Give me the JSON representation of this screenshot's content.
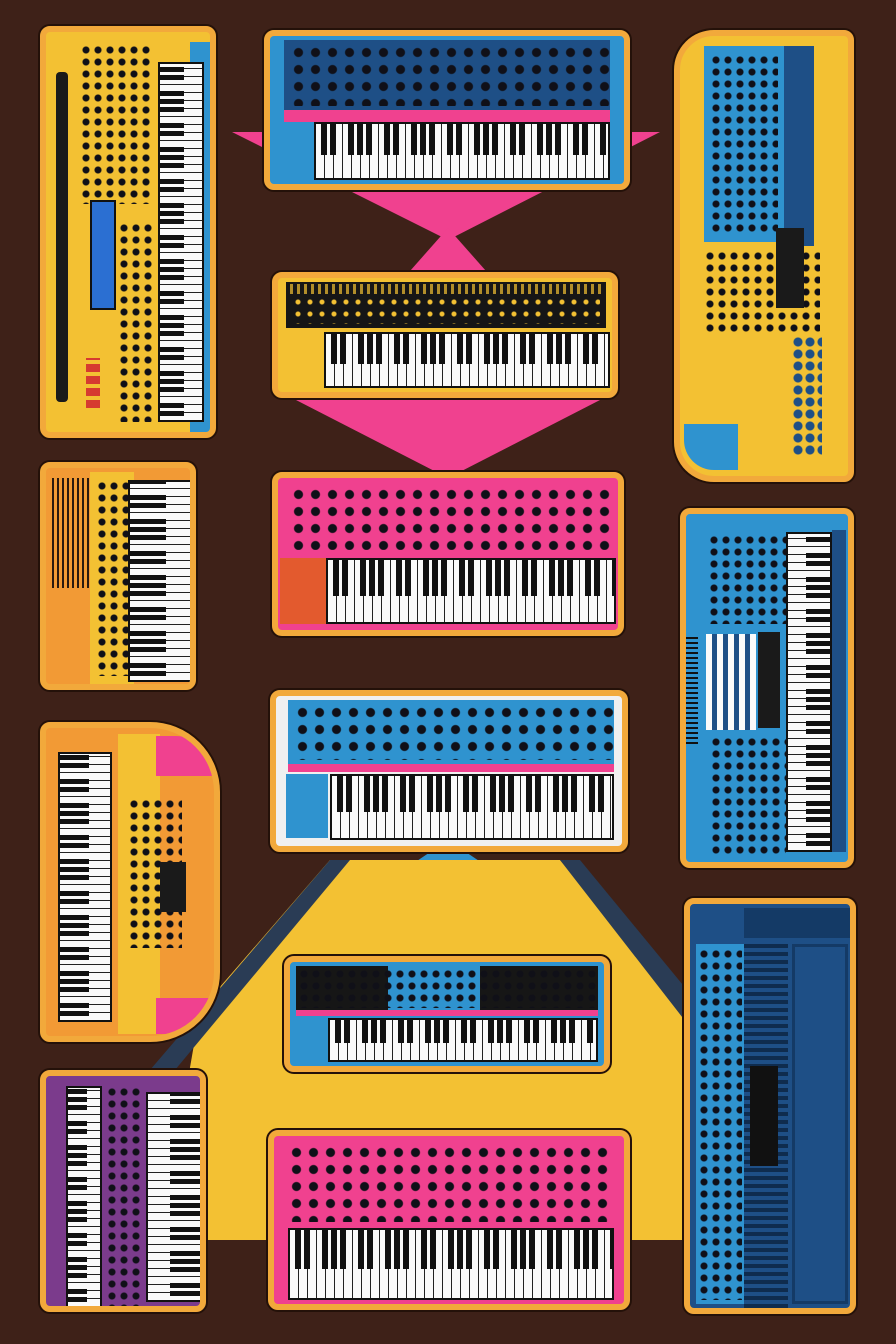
{
  "scene": {
    "description_colors": {
      "background": "#3e2118",
      "pink": "#f0418f",
      "blue": "#2f93cf",
      "yellow": "#f3c133",
      "orange": "#f29a35",
      "purple": "#7b3b8c",
      "navy": "#1e4f86",
      "outline": "#f2a93b"
    }
  },
  "synths": [
    {
      "id": "left-1",
      "color": "yellow"
    },
    {
      "id": "center-1",
      "color": "navy"
    },
    {
      "id": "right-1",
      "color": "yellow"
    },
    {
      "id": "center-2",
      "color": "yellow"
    },
    {
      "id": "left-2",
      "color": "orange"
    },
    {
      "id": "center-3",
      "color": "pink"
    },
    {
      "id": "right-2",
      "color": "blue"
    },
    {
      "id": "center-4",
      "color": "blue"
    },
    {
      "id": "left-3",
      "color": "orange"
    },
    {
      "id": "center-5",
      "color": "blue"
    },
    {
      "id": "right-3",
      "color": "navy"
    },
    {
      "id": "left-4",
      "color": "purple"
    },
    {
      "id": "center-6",
      "color": "pink"
    }
  ]
}
